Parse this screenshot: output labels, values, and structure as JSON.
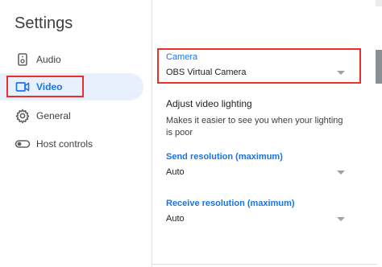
{
  "sidebar": {
    "title": "Settings",
    "items": [
      {
        "label": "Audio",
        "icon": "speaker-icon",
        "active": false
      },
      {
        "label": "Video",
        "icon": "video-camera-icon",
        "active": true
      },
      {
        "label": "General",
        "icon": "gear-icon",
        "active": false
      },
      {
        "label": "Host controls",
        "icon": "toggle-icon",
        "active": false
      }
    ]
  },
  "video": {
    "camera": {
      "label": "Camera",
      "value": "OBS Virtual Camera"
    },
    "lighting": {
      "heading": "Adjust video lighting",
      "description": "Makes it easier to see you when your lighting is poor"
    },
    "send_resolution": {
      "label": "Send resolution (maximum)",
      "value": "Auto"
    },
    "receive_resolution": {
      "label": "Receive resolution (maximum)",
      "value": "Auto"
    }
  },
  "colors": {
    "accent": "#1a73e8",
    "active_bg": "#e8f0fe",
    "annotation": "#e8302d"
  }
}
